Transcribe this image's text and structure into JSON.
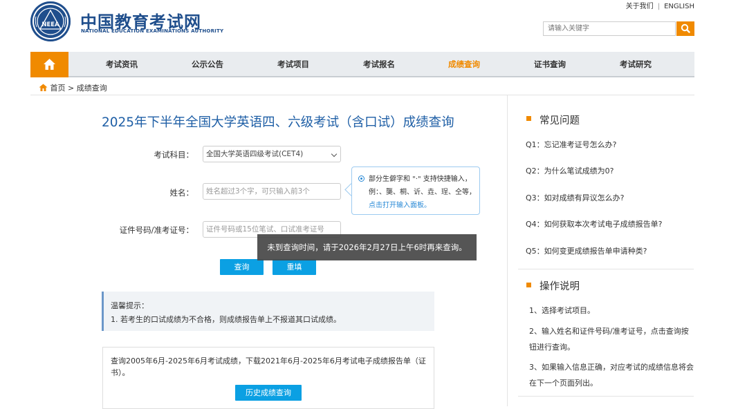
{
  "header": {
    "logo_cn": "中国教育考试网",
    "logo_en": "NATIONAL EDUCATION EXAMINATIONS AUTHORITY",
    "logo_seal_text": "NEEA",
    "about": "关于我们",
    "separator": "|",
    "english": "ENGLISH",
    "search_placeholder": "请输入关键字"
  },
  "nav": {
    "items": [
      {
        "label": "考试资讯"
      },
      {
        "label": "公示公告"
      },
      {
        "label": "考试项目"
      },
      {
        "label": "考试报名"
      },
      {
        "label": "成绩查询"
      },
      {
        "label": "证书查询"
      },
      {
        "label": "考试研究"
      }
    ],
    "active_index": 4
  },
  "breadcrumb": {
    "home": "首页",
    "sep": ">",
    "current": "成绩查询"
  },
  "main": {
    "title": "2025年下半年全国大学英语四、六级考试（含口试）成绩查询",
    "form": {
      "subject_label": "考试科目：",
      "subject_value": "全国大学英语四级考试(CET4)",
      "name_label": "姓名：",
      "name_placeholder": "姓名超过3个字，可只输入前3个",
      "id_label": "证件号码/准考证号：",
      "id_placeholder": "证件号码或15位笔试、口试准考证号",
      "query_button": "查询",
      "reset_button": "重填"
    },
    "tip": {
      "text": "部分生僻字和 \"·\" 支持快捷输入，例：、龑、桐、䜣、垚、珵、仝等，",
      "link": "点击打开输入面板。"
    },
    "toast": "未到查询时间，请于2026年2月27日上午6时再来查询。",
    "notice": {
      "title": "温馨提示：",
      "items": [
        "1. 若考生的口试成绩为不合格，则成绩报告单上不报道其口试成绩。"
      ]
    },
    "history": {
      "text": "查询2005年6月-2025年6月考试成绩，下载2021年6月-2025年6月考试电子成绩报告单（证书）。",
      "button": "历史成绩查询"
    }
  },
  "sidebar": {
    "faq_title": "常见问题",
    "faq": [
      "Q1：忘记准考证号怎么办?",
      "Q2：为什么笔试成绩为0?",
      "Q3：如对成绩有异议怎么办?",
      "Q4：如何获取本次考试电子成绩报告单?",
      "Q5：如何变更成绩报告单申请种类?"
    ],
    "ops_title": "操作说明",
    "ops": [
      "1、选择考试项目。",
      "2、输入姓名和证件号码/准考证号，点击查询按钮进行查询。",
      "3、如果输入信息正确，对应考试的成绩信息将会在下一个页面列出。"
    ]
  },
  "colors": {
    "brand": "#1f4e8c",
    "accent": "#f08a00",
    "button": "#0ba0e3",
    "link": "#2a8ad6"
  }
}
